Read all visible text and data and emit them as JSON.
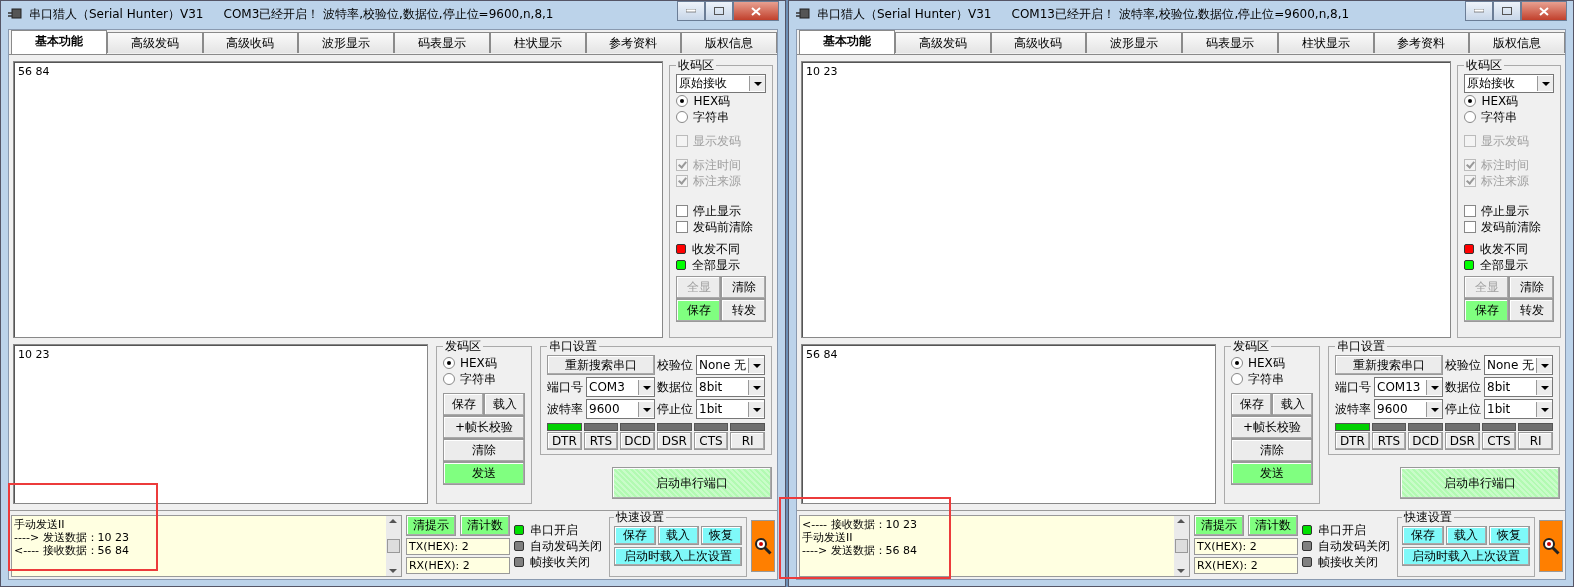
{
  "windows": [
    {
      "title": "串口猎人（Serial Hunter）V31",
      "status": "COM3已经开启！ 波特率,校验位,数据位,停止位=9600,n,8,1",
      "tabs": [
        {
          "label": "基本功能",
          "selected": true
        },
        {
          "label": "高级发码",
          "selected": false
        },
        {
          "label": "高级收码",
          "selected": false
        },
        {
          "label": "波形显示",
          "selected": false
        },
        {
          "label": "码表显示",
          "selected": false
        },
        {
          "label": "柱状显示",
          "selected": false
        },
        {
          "label": "参考资料",
          "selected": false
        },
        {
          "label": "版权信息",
          "selected": false
        }
      ],
      "receive_text": "56 84",
      "receive_panel": {
        "legend": "收码区",
        "mode": "原始接收",
        "radios": [
          {
            "label": "HEX码",
            "selected": true
          },
          {
            "label": "字符串",
            "selected": false
          }
        ],
        "options": [
          {
            "label": "显示发码",
            "checked": false,
            "disabled": true
          },
          {
            "label": "标注时间",
            "checked": true,
            "disabled": true
          },
          {
            "label": "标注来源",
            "checked": true,
            "disabled": true
          },
          {
            "label": "停止显示",
            "checked": false,
            "disabled": false
          },
          {
            "label": "发码前清除",
            "checked": false,
            "disabled": false
          }
        ],
        "indicators": [
          {
            "label": "收发不同",
            "color": "#ff0000"
          },
          {
            "label": "全部显示",
            "color": "#00ff00"
          }
        ],
        "buttons": [
          {
            "label": "全显",
            "disabled": true,
            "highlighted": false
          },
          {
            "label": "清除",
            "disabled": false,
            "highlighted": false
          },
          {
            "label": "保存",
            "disabled": false,
            "highlighted": true
          },
          {
            "label": "转发",
            "disabled": false,
            "highlighted": false
          }
        ]
      },
      "send_text": "10 23",
      "send_panel": {
        "legend": "发码区",
        "radios": [
          {
            "label": "HEX码",
            "selected": true
          },
          {
            "label": "字符串",
            "selected": false
          }
        ],
        "buttons": [
          {
            "label": "保存",
            "kind": "half",
            "highlighted": false
          },
          {
            "label": "载入",
            "kind": "half",
            "highlighted": false
          },
          {
            "label": "+帧长校验",
            "kind": "wide",
            "highlighted": false
          },
          {
            "label": "清除",
            "kind": "wide",
            "highlighted": false
          },
          {
            "label": "发送",
            "kind": "wide",
            "highlighted": true
          }
        ]
      },
      "port_settings": {
        "legend": "串口设置",
        "rescan_button": "重新搜索串口",
        "fields": [
          {
            "label": "校验位",
            "value": "None 无"
          },
          {
            "label": "端口号",
            "value": "COM3"
          },
          {
            "label": "数据位",
            "value": "8bit"
          },
          {
            "label": "波特率",
            "value": "9600"
          },
          {
            "label": "停止位",
            "value": "1bit"
          }
        ],
        "lines": [
          {
            "label": "DTR",
            "on": true
          },
          {
            "label": "RTS",
            "on": false
          },
          {
            "label": "DCD",
            "on": false
          },
          {
            "label": "DSR",
            "on": false
          },
          {
            "label": "CTS",
            "on": false
          },
          {
            "label": "RI",
            "on": false
          }
        ]
      },
      "start_button": "启动串行端口",
      "log": [
        "手动发送II",
        "----> 发送数据：10 23",
        "<---- 接收数据：56 84"
      ],
      "clear_hint_button": "清提示",
      "clear_count_button": "清计数",
      "counters": [
        {
          "label": "TX(HEX):",
          "value": "2"
        },
        {
          "label": "RX(HEX):",
          "value": "2"
        }
      ],
      "status_indicators": [
        {
          "label": "串口开启",
          "color": "#00e000"
        },
        {
          "label": "自动发码关闭",
          "color": "#808080"
        },
        {
          "label": "帧接收关闭",
          "color": "#808080"
        }
      ],
      "quick_settings": {
        "legend": "快速设置",
        "buttons": [
          "保存",
          "载入",
          "恢复"
        ],
        "load_on_start": "启动时载入上次设置"
      }
    },
    {
      "title": "串口猎人（Serial Hunter）V31",
      "status": "COM13已经开启！ 波特率,校验位,数据位,停止位=9600,n,8,1",
      "tabs": [
        {
          "label": "基本功能",
          "selected": true
        },
        {
          "label": "高级发码",
          "selected": false
        },
        {
          "label": "高级收码",
          "selected": false
        },
        {
          "label": "波形显示",
          "selected": false
        },
        {
          "label": "码表显示",
          "selected": false
        },
        {
          "label": "柱状显示",
          "selected": false
        },
        {
          "label": "参考资料",
          "selected": false
        },
        {
          "label": "版权信息",
          "selected": false
        }
      ],
      "receive_text": "10 23",
      "receive_panel": {
        "legend": "收码区",
        "mode": "原始接收",
        "radios": [
          {
            "label": "HEX码",
            "selected": true
          },
          {
            "label": "字符串",
            "selected": false
          }
        ],
        "options": [
          {
            "label": "显示发码",
            "checked": false,
            "disabled": true
          },
          {
            "label": "标注时间",
            "checked": true,
            "disabled": true
          },
          {
            "label": "标注来源",
            "checked": true,
            "disabled": true
          },
          {
            "label": "停止显示",
            "checked": false,
            "disabled": false
          },
          {
            "label": "发码前清除",
            "checked": false,
            "disabled": false
          }
        ],
        "indicators": [
          {
            "label": "收发不同",
            "color": "#ff0000"
          },
          {
            "label": "全部显示",
            "color": "#00ff00"
          }
        ],
        "buttons": [
          {
            "label": "全显",
            "disabled": true,
            "highlighted": false
          },
          {
            "label": "清除",
            "disabled": false,
            "highlighted": false
          },
          {
            "label": "保存",
            "disabled": false,
            "highlighted": true
          },
          {
            "label": "转发",
            "disabled": false,
            "highlighted": false
          }
        ]
      },
      "send_text": "56 84",
      "send_panel": {
        "legend": "发码区",
        "radios": [
          {
            "label": "HEX码",
            "selected": true
          },
          {
            "label": "字符串",
            "selected": false
          }
        ],
        "buttons": [
          {
            "label": "保存",
            "kind": "half",
            "highlighted": false
          },
          {
            "label": "载入",
            "kind": "half",
            "highlighted": false
          },
          {
            "label": "+帧长校验",
            "kind": "wide",
            "highlighted": false
          },
          {
            "label": "清除",
            "kind": "wide",
            "highlighted": false
          },
          {
            "label": "发送",
            "kind": "wide",
            "highlighted": true
          }
        ]
      },
      "port_settings": {
        "legend": "串口设置",
        "rescan_button": "重新搜索串口",
        "fields": [
          {
            "label": "校验位",
            "value": "None 无"
          },
          {
            "label": "端口号",
            "value": "COM13"
          },
          {
            "label": "数据位",
            "value": "8bit"
          },
          {
            "label": "波特率",
            "value": "9600"
          },
          {
            "label": "停止位",
            "value": "1bit"
          }
        ],
        "lines": [
          {
            "label": "DTR",
            "on": true
          },
          {
            "label": "RTS",
            "on": false
          },
          {
            "label": "DCD",
            "on": false
          },
          {
            "label": "DSR",
            "on": false
          },
          {
            "label": "CTS",
            "on": false
          },
          {
            "label": "RI",
            "on": false
          }
        ]
      },
      "start_button": "启动串行端口",
      "log": [
        "<---- 接收数据：10 23",
        "手动发送II",
        "----> 发送数据：56 84"
      ],
      "clear_hint_button": "清提示",
      "clear_count_button": "清计数",
      "counters": [
        {
          "label": "TX(HEX):",
          "value": "2"
        },
        {
          "label": "RX(HEX):",
          "value": "2"
        }
      ],
      "status_indicators": [
        {
          "label": "串口开启",
          "color": "#00e000"
        },
        {
          "label": "自动发码关闭",
          "color": "#808080"
        },
        {
          "label": "帧接收关闭",
          "color": "#808080"
        }
      ],
      "quick_settings": {
        "legend": "快速设置",
        "buttons": [
          "保存",
          "载入",
          "恢复"
        ],
        "load_on_start": "启动时载入上次设置"
      }
    }
  ]
}
